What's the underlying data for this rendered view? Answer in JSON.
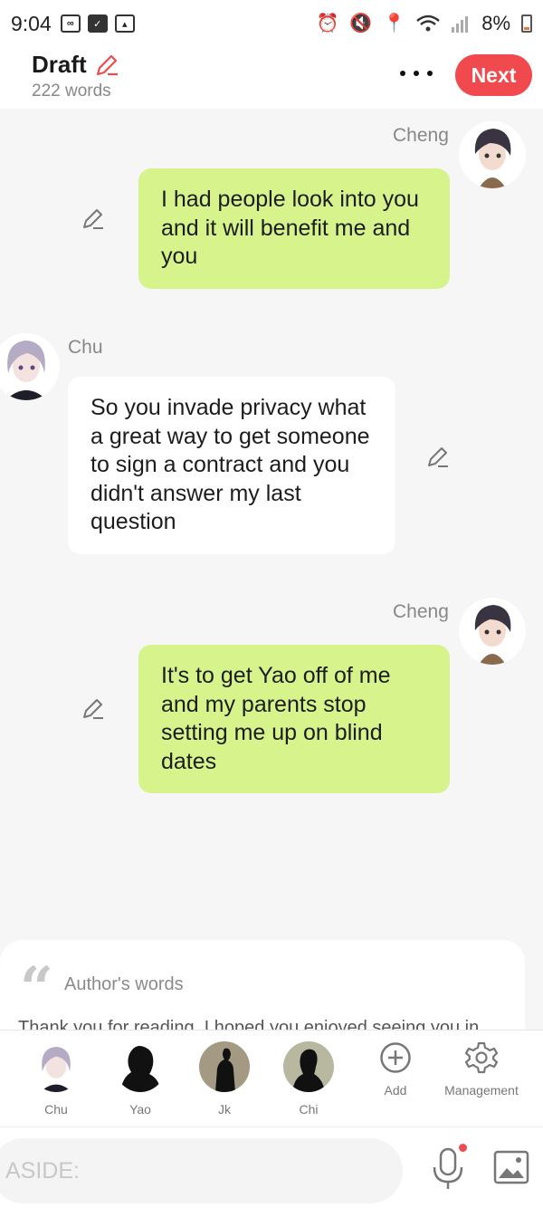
{
  "status_bar": {
    "time": "9:04",
    "battery": "8%"
  },
  "header": {
    "title": "Draft",
    "word_count": "222 words",
    "next_label": "Next"
  },
  "messages": [
    {
      "speaker": "Cheng",
      "text": "I had people look into you and it will benefit me and you",
      "side": "right"
    },
    {
      "speaker": "Chu",
      "text": "So you invade privacy what a great way to get someone to sign a contract and you didn't answer my last question",
      "side": "left"
    },
    {
      "speaker": "Cheng",
      "text": "It's to get Yao off of me and my parents stop setting me up on blind dates",
      "side": "right"
    }
  ],
  "author_words": {
    "label": "Author's words",
    "preview": "Thank you for reading. I hoped you enjoyed seeing you in"
  },
  "characters": [
    {
      "name": "Chu"
    },
    {
      "name": "Yao"
    },
    {
      "name": "Jk"
    },
    {
      "name": "Chi"
    }
  ],
  "tools": {
    "add_label": "Add",
    "management_label": "Management"
  },
  "input": {
    "placeholder": "ASIDE:"
  },
  "colors": {
    "accent": "#f04a4f",
    "green_bubble": "#d6f38c",
    "background": "#f6f6f6"
  }
}
